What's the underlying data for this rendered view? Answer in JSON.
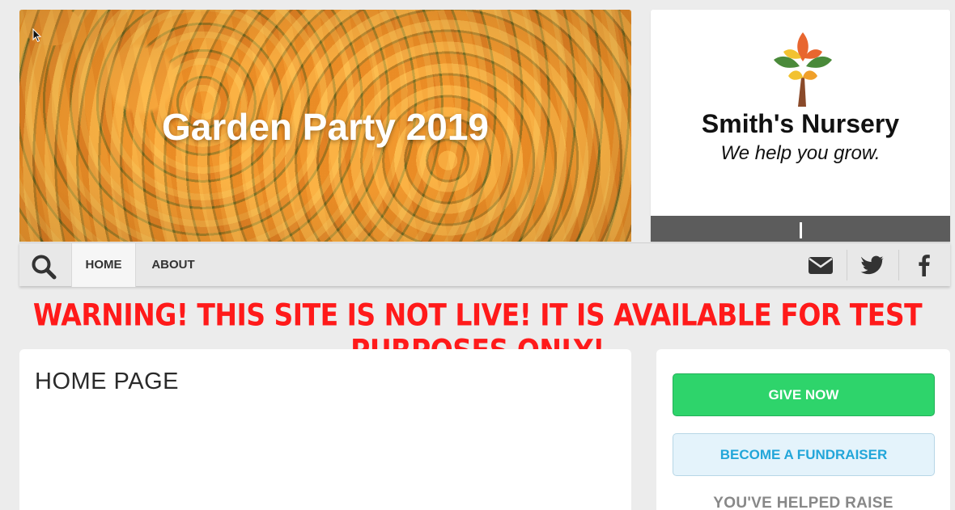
{
  "hero": {
    "title": "Garden Party 2019"
  },
  "sponsor": {
    "name": "Smith's Nursery",
    "tagline": "We help you grow."
  },
  "nav": {
    "items": [
      {
        "label": "HOME",
        "active": true
      },
      {
        "label": "ABOUT",
        "active": false
      }
    ],
    "icons": [
      "search-icon",
      "envelope-icon",
      "twitter-icon",
      "facebook-icon"
    ]
  },
  "warning": {
    "text": "WARNING! THIS SITE IS NOT LIVE! IT IS AVAILABLE FOR TEST PURPOSES ONLY!",
    "color": "#ff1a1a"
  },
  "main": {
    "title": "HOME PAGE"
  },
  "sidebar": {
    "give_label": "GIVE NOW",
    "fundraiser_label": "BECOME A FUNDRAISER",
    "helped_text": "YOU'VE HELPED RAISE"
  },
  "colors": {
    "give_button": "#2ed46b",
    "fundraiser_text": "#22a6d9",
    "nav_background": "#e8e8e8"
  }
}
